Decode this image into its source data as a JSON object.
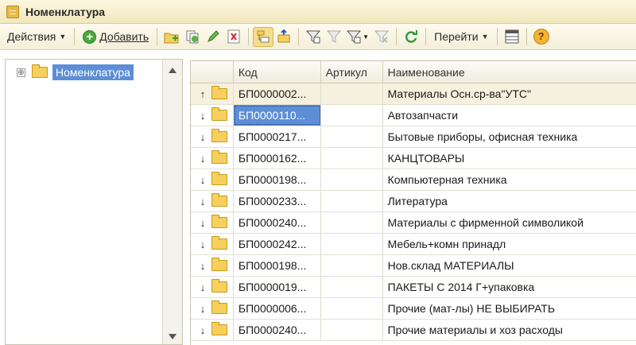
{
  "window": {
    "title": "Номенклатура",
    "icon": "catalog-icon"
  },
  "toolbar": {
    "actions_label": "Действия",
    "add_label": "Добавить",
    "goto_label": "Перейти",
    "icons": [
      "add-folder-icon",
      "copy-icon",
      "edit-pencil-icon",
      "delete-mark-icon",
      "hierarchy-view-icon",
      "move-to-group-icon",
      "filter-icon",
      "filter-disabled-icon",
      "filter-dropdown-icon",
      "clear-filter-icon",
      "refresh-icon",
      "list-settings-icon",
      "help-icon"
    ]
  },
  "tree": {
    "root_label": "Номенклатура",
    "expander": "⊕"
  },
  "grid": {
    "columns": [
      "Код",
      "Артикул",
      "Наименование"
    ],
    "rows": [
      {
        "code": "БП0000002...",
        "article": "",
        "name": "Материалы Осн.ср-ва\"УТС\"",
        "arrow": "up"
      },
      {
        "code": "БП0000110...",
        "article": "",
        "name": "Автозапчасти",
        "arrow": "down"
      },
      {
        "code": "БП0000217...",
        "article": "",
        "name": "Бытовые приборы, офисная техника",
        "arrow": "down"
      },
      {
        "code": "БП0000162...",
        "article": "",
        "name": "КАНЦТОВАРЫ",
        "arrow": "down"
      },
      {
        "code": "БП0000198...",
        "article": "",
        "name": "Компьютерная техника",
        "arrow": "down"
      },
      {
        "code": "БП0000233...",
        "article": "",
        "name": "Литература",
        "arrow": "down"
      },
      {
        "code": "БП0000240...",
        "article": "",
        "name": "Материалы с фирменной символикой",
        "arrow": "down"
      },
      {
        "code": "БП0000242...",
        "article": "",
        "name": "Мебель+комн принадл",
        "arrow": "down"
      },
      {
        "code": "БП0000198...",
        "article": "",
        "name": "Нов.склад МАТЕРИАЛЫ",
        "arrow": "down"
      },
      {
        "code": "БП0000019...",
        "article": "",
        "name": "ПАКЕТЫ С 2014 Г+упаковка",
        "arrow": "down"
      },
      {
        "code": "БП0000006...",
        "article": "",
        "name": "Прочие (мат-лы) НЕ ВЫБИРАТЬ",
        "arrow": "down"
      },
      {
        "code": "БП0000240...",
        "article": "",
        "name": "Прочие материалы и хоз расходы",
        "arrow": "down"
      }
    ]
  },
  "colors": {
    "selection": "#5c8fd6",
    "title_bar": "#f1e8bd",
    "folder": "#f6cf5c"
  }
}
